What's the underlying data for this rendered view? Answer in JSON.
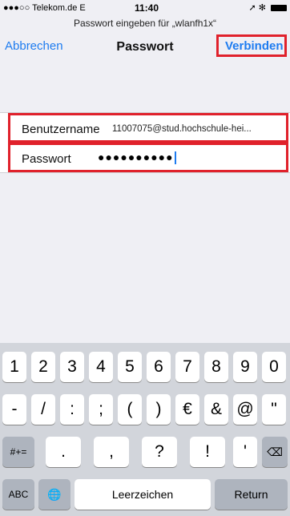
{
  "status_bar": {
    "carrier": "●●●○○ Telekom.de  E",
    "time": "11:40",
    "indicators": "➚ ✻"
  },
  "prompt": "Passwort eingeben für „wlanfh1x“",
  "nav": {
    "cancel": "Abbrechen",
    "title": "Passwort",
    "connect": "Verbinden"
  },
  "form": {
    "username_label": "Benutzername",
    "username_value": "11007075@stud.hochschule-hei...",
    "password_label": "Passwort",
    "password_value": "●●●●●●●●●●"
  },
  "keyboard": {
    "row1": [
      "1",
      "2",
      "3",
      "4",
      "5",
      "6",
      "7",
      "8",
      "9",
      "0"
    ],
    "row2": [
      "-",
      "/",
      ":",
      ";",
      "(",
      ")",
      "€",
      "&",
      "@",
      "\""
    ],
    "row3": [
      "#+=",
      ".",
      ",",
      "?",
      "!",
      "'",
      "⌫"
    ],
    "row4": [
      "ABC",
      "🌐",
      "Leerzeichen",
      "Return"
    ]
  },
  "colors": {
    "accent": "#1e7cf0",
    "highlight": "#e0212b"
  }
}
